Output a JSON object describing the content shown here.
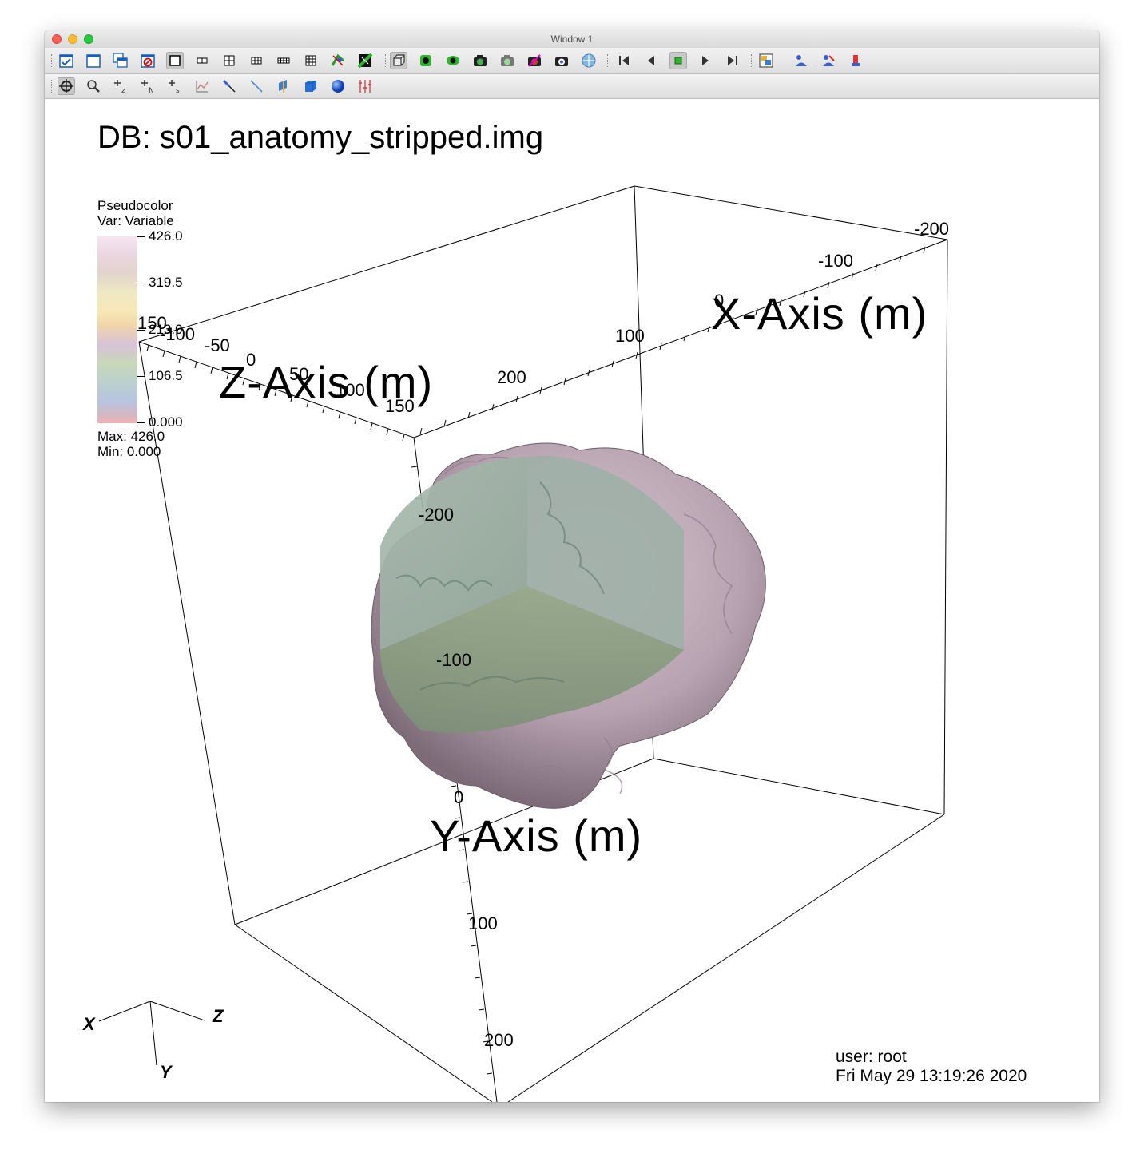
{
  "window": {
    "title": "Window 1"
  },
  "toolbar1": {
    "buttons": [
      {
        "icon": "active-window-icon"
      },
      {
        "icon": "new-window-icon"
      },
      {
        "icon": "clone-window-icon"
      },
      {
        "icon": "delete-window-icon"
      },
      {
        "icon": "layout-1x1-icon"
      },
      {
        "icon": "layout-1x2-icon"
      },
      {
        "icon": "layout-2x2-icon"
      },
      {
        "icon": "layout-2x3-icon"
      },
      {
        "icon": "layout-2x4-icon"
      },
      {
        "icon": "layout-3x3-icon"
      },
      {
        "icon": "lock-view-icon"
      },
      {
        "icon": "lock-time-icon"
      },
      {
        "icon": "view-3d-box-icon"
      },
      {
        "icon": "draw-plots-icon"
      },
      {
        "icon": "hide-plots-icon"
      },
      {
        "icon": "save-window-icon"
      },
      {
        "icon": "print-window-icon"
      },
      {
        "icon": "clear-plots-icon"
      },
      {
        "icon": "copy-plots-icon"
      },
      {
        "icon": "reset-view-icon"
      },
      {
        "icon": "skip-back-icon"
      },
      {
        "icon": "play-reverse-icon"
      },
      {
        "icon": "stop-icon"
      },
      {
        "icon": "play-icon"
      },
      {
        "icon": "skip-forward-icon"
      },
      {
        "icon": "pick-icon"
      },
      {
        "icon": "lighting-icon"
      },
      {
        "icon": "spin-icon"
      },
      {
        "icon": "undo-view-icon"
      }
    ]
  },
  "toolbar2": {
    "buttons": [
      {
        "icon": "navigate-icon"
      },
      {
        "icon": "zoom-icon"
      },
      {
        "icon": "zone-pick-icon"
      },
      {
        "icon": "node-pick-icon"
      },
      {
        "icon": "spreadsheet-pick-icon"
      },
      {
        "icon": "curve-pick-icon"
      },
      {
        "icon": "lineout-icon"
      },
      {
        "icon": "line-icon"
      },
      {
        "icon": "plane-tool-icon"
      },
      {
        "icon": "box-tool-icon"
      },
      {
        "icon": "sphere-tool-icon"
      },
      {
        "icon": "axis-restriction-icon"
      }
    ]
  },
  "viewport": {
    "db_title": "DB: s01_anatomy_stripped.img",
    "legend": {
      "plot_type": "Pseudocolor",
      "var": "Var: Variable",
      "ticks": [
        "426.0",
        "319.5",
        "213.0",
        "106.5",
        "0.000"
      ],
      "max": "Max:  426.0",
      "min": "Min:  0.000"
    },
    "axes": {
      "x_label": "X-Axis (m)",
      "y_label": "Y-Axis (m)",
      "z_label": "Z-Axis (m)",
      "x_ticks": [
        "-200",
        "-100",
        "0",
        "100",
        "200"
      ],
      "z_ticks": [
        "-100",
        "-50",
        "0",
        "50",
        "100",
        "150"
      ],
      "y_ticks": [
        "-200",
        "-100",
        "0",
        "100",
        "200"
      ],
      "stray_label": "150"
    },
    "triad": {
      "x": "X",
      "y": "Y",
      "z": "Z"
    },
    "user": "user: root",
    "date": "Fri May 29 13:19:26 2020"
  }
}
